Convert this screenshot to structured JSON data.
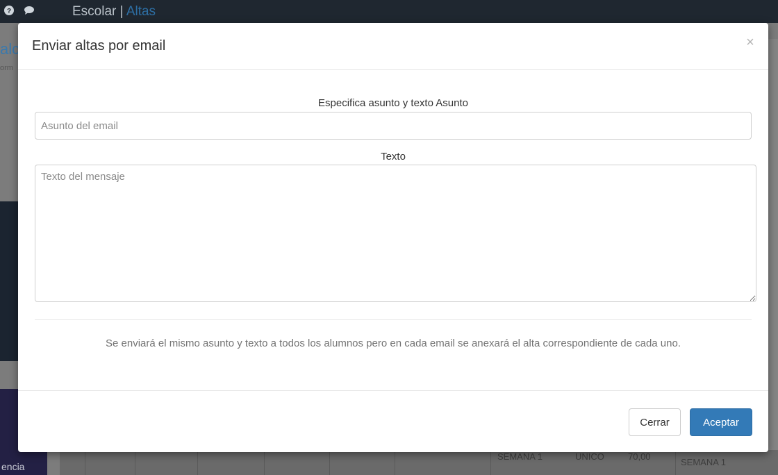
{
  "app": {
    "section": "Escolar",
    "separator": "|",
    "current_page": "Altas"
  },
  "background": {
    "sidebar_item_partial": "encia",
    "left_label_partial": "alc",
    "left_sublabel_partial": "orm",
    "table_cells": [
      "SEMANA 1",
      "UNICO",
      "70,00",
      "SEMANA 1"
    ]
  },
  "modal": {
    "title": "Enviar altas por email",
    "close_symbol": "×",
    "subject_label": "Especifica asunto y texto Asunto",
    "subject_placeholder": "Asunto del email",
    "subject_value": "",
    "text_label": "Texto",
    "text_placeholder": "Texto del mensaje",
    "text_value": "",
    "info": "Se enviará el mismo asunto y texto a todos los alumnos pero en cada email se anexará el alta correspondiente de cada uno.",
    "buttons": {
      "close": "Cerrar",
      "accept": "Aceptar"
    }
  },
  "colors": {
    "primary": "#337ab7",
    "topbar": "#1f2730",
    "backdrop": "#7c7c7c"
  }
}
